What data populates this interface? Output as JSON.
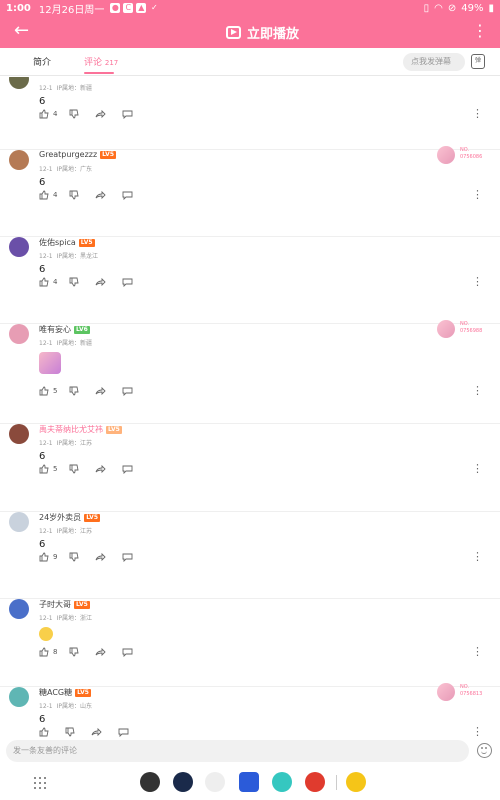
{
  "status": {
    "time": "1:00",
    "date": "12月26日周一",
    "battery": "49%"
  },
  "header": {
    "back_icon": "arrow-left-icon",
    "title": "立即播放",
    "more_icon": "more-vertical-icon"
  },
  "tabs": {
    "intro": "简介",
    "comments": "评论",
    "comments_count": "217"
  },
  "danmu": {
    "placeholder": "点我发弹幕",
    "icon_label": "弹"
  },
  "comments": [
    {
      "name": "",
      "level": "LV5",
      "level_color": "#ffb37c",
      "date": "12-1",
      "ip": "IP属地：新疆",
      "text": "6",
      "likes": "4",
      "avatar_color": "#6b6b4a",
      "has_badge": false
    },
    {
      "name": "Greatpurgezzz",
      "level": "LV5",
      "level_color": "#ff6f1d",
      "date": "12-1",
      "ip": "IP属地：广东",
      "text": "6",
      "likes": "4",
      "avatar_color": "#b57a55",
      "has_badge": true,
      "badge": {
        "no": "NO.",
        "num": "0756086"
      }
    },
    {
      "name": "佐佑spica",
      "level": "LV5",
      "level_color": "#ff6f1d",
      "date": "12-1",
      "ip": "IP属地：黑龙江",
      "text": "6",
      "likes": "4",
      "avatar_color": "#6a4fa8",
      "has_badge": false
    },
    {
      "name": "唯有妄心",
      "level": "LV6",
      "level_color": "#5cc461",
      "date": "12-1",
      "ip": "IP属地：新疆",
      "text": "",
      "sticker": true,
      "likes": "5",
      "avatar_color": "#e79db4",
      "has_badge": true,
      "badge": {
        "no": "NO.",
        "num": "0756988"
      }
    },
    {
      "name": "禹夫蒂纳比尤艾祎",
      "level": "LV5",
      "level_color": "#ffb37c",
      "date": "12-1",
      "ip": "IP属地：江苏",
      "text": "6",
      "likes": "5",
      "avatar_color": "#8a4a3c",
      "pink": true,
      "has_badge": false
    },
    {
      "name": "24岁外卖员",
      "level": "LV5",
      "level_color": "#ff6f1d",
      "date": "12-1",
      "ip": "IP属地：江苏",
      "text": "6",
      "likes": "9",
      "avatar_color": "#c9d2dd",
      "has_badge": false
    },
    {
      "name": "子时大哥",
      "level": "LV5",
      "level_color": "#ff6f1d",
      "date": "12-1",
      "ip": "IP属地：浙江",
      "text": "",
      "sticker_emoji": true,
      "likes": "8",
      "avatar_color": "#4a6fc9",
      "has_badge": false
    },
    {
      "name": "糖ACG糖",
      "level": "LV5",
      "level_color": "#ff6f1d",
      "date": "12-1",
      "ip": "IP属地：山东",
      "text": "6",
      "likes": "",
      "avatar_color": "#5fb6b4",
      "has_badge": true,
      "badge": {
        "no": "NO.",
        "num": "0756813"
      }
    }
  ],
  "reply": {
    "placeholder": "发一条友善的评论"
  },
  "dock_apps": [
    {
      "name": "app-vector",
      "color": "#333333"
    },
    {
      "name": "app-camera",
      "color": "#1a2a4a"
    },
    {
      "name": "app-messages",
      "color": "#eeeeee"
    },
    {
      "name": "app-notes",
      "color": "#2b5bd9"
    },
    {
      "name": "app-browser",
      "color": "#35c7c0"
    },
    {
      "name": "app-netease",
      "color": "#e03b2e"
    },
    {
      "name": "app-qq",
      "color": "#f5c518"
    }
  ]
}
